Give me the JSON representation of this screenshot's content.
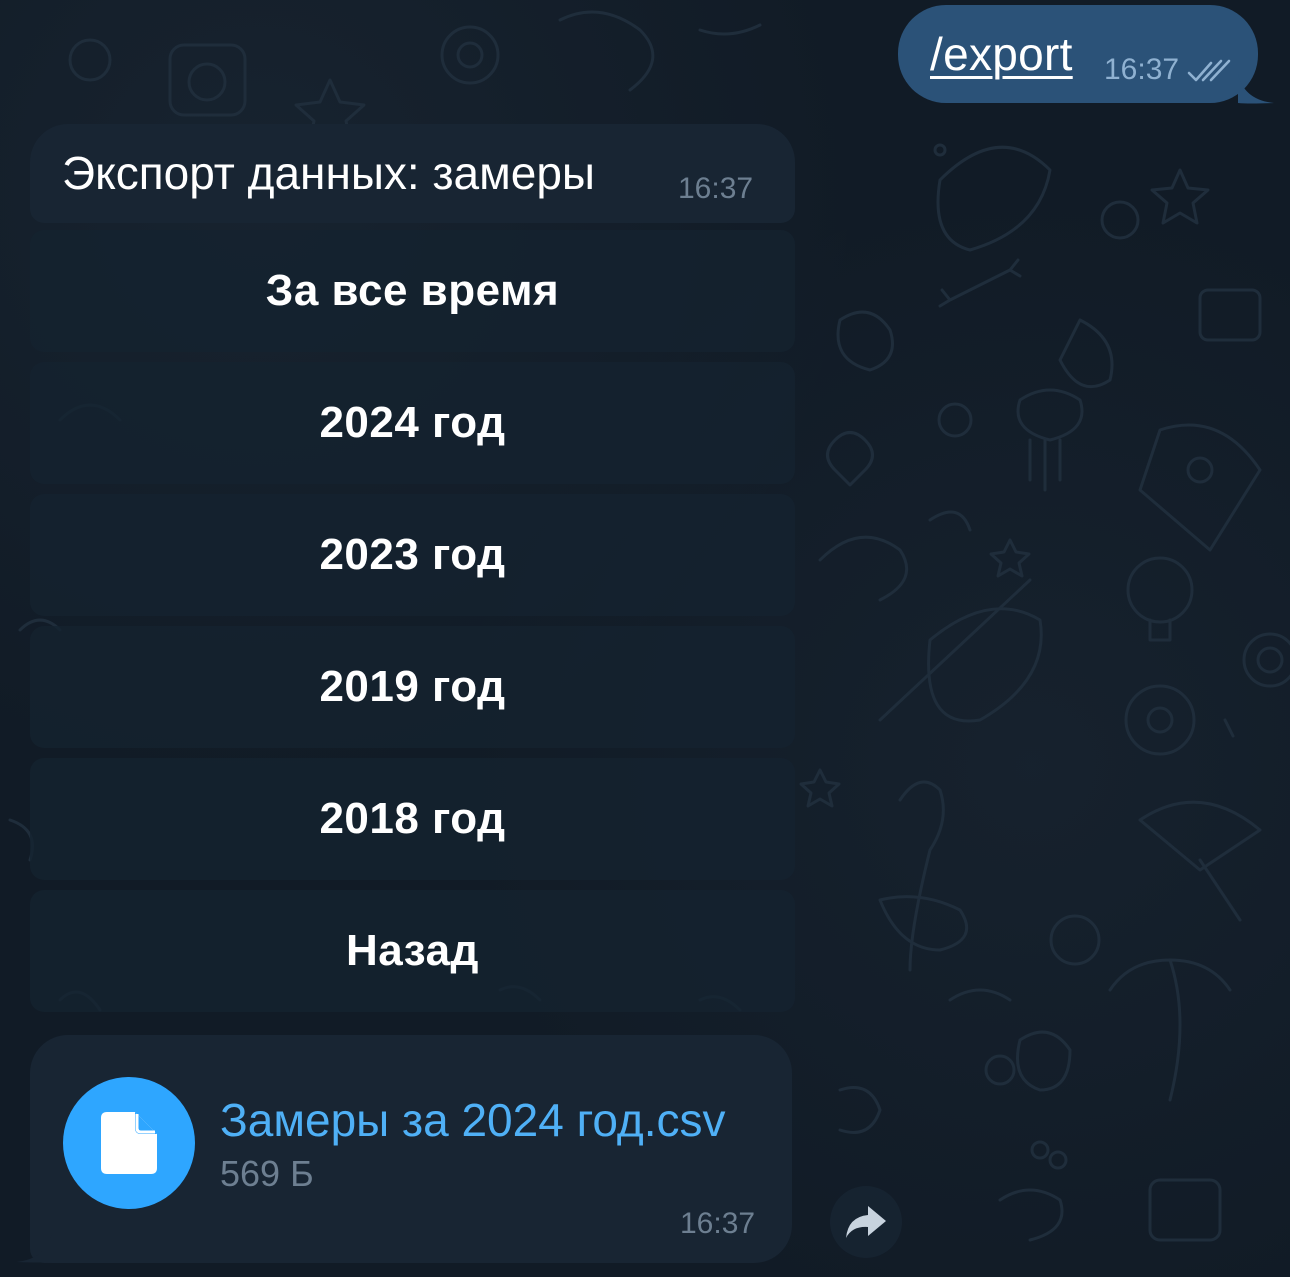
{
  "outgoing": {
    "text": "/export",
    "time": "16:37",
    "status_icon": "double-check-icon"
  },
  "incoming": {
    "text": "Экспорт данных: замеры",
    "time": "16:37"
  },
  "keyboard": {
    "buttons": [
      "За все время",
      "2024 год",
      "2023 год",
      "2019 год",
      "2018 год",
      "Назад"
    ]
  },
  "file": {
    "name": "Замеры за 2024 год.csv",
    "size": "569 Б",
    "time": "16:37",
    "icon": "document-icon"
  },
  "forward": {
    "icon": "forward-arrow-icon"
  },
  "colors": {
    "background": "#0e1621",
    "outgoing_bubble": "#2b5278",
    "incoming_bubble": "#182533",
    "accent": "#2ea6ff",
    "link": "#4fb0f6"
  }
}
